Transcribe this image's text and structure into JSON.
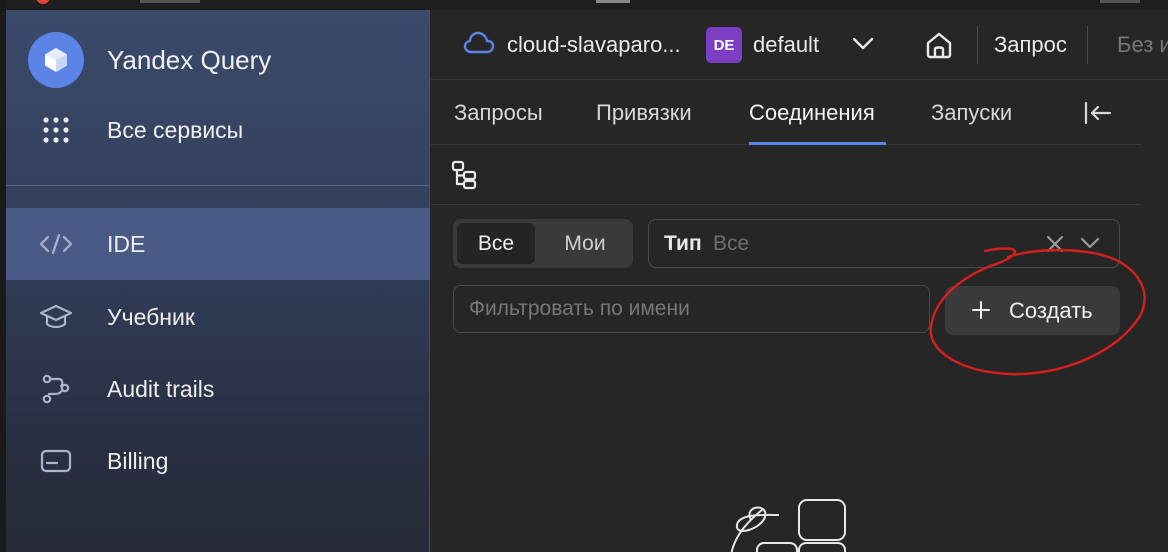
{
  "sidebar": {
    "brand_title": "Yandex Query",
    "all_services": "Все сервисы",
    "items": [
      {
        "label": "IDE",
        "active": true,
        "icon": "code-icon"
      },
      {
        "label": "Учебник",
        "active": false,
        "icon": "graduation-cap-icon"
      },
      {
        "label": "Audit trails",
        "active": false,
        "icon": "route-icon"
      },
      {
        "label": "Billing",
        "active": false,
        "icon": "credit-card-icon"
      }
    ]
  },
  "header": {
    "cloud_name": "cloud-slavaparo...",
    "db_badge": "DE",
    "db_name": "default",
    "query_label": "Запрос",
    "query_name": "Без и"
  },
  "tabs": [
    {
      "label": "Запросы",
      "active": false
    },
    {
      "label": "Привязки",
      "active": false
    },
    {
      "label": "Соединения",
      "active": true
    },
    {
      "label": "Запуски",
      "active": false
    }
  ],
  "filters": {
    "segment": [
      "Все",
      "Мои"
    ],
    "type_label": "Тип",
    "type_value": "Все",
    "name_placeholder": "Фильтровать по имени"
  },
  "actions": {
    "create_label": "Создать"
  },
  "colors": {
    "accent": "#5b84e6",
    "badge": "#7c3fc4",
    "annotation": "#d61f1f"
  }
}
